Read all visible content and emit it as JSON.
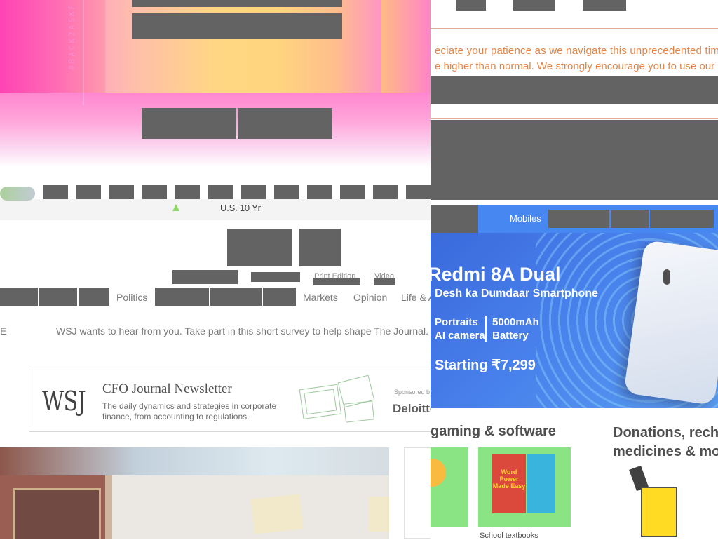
{
  "hero": {
    "vertical_text": "#BACK2ASKF"
  },
  "ticker": {
    "label": "U.S. 10 Yr",
    "direction": "up",
    "up_color": "#7cd34a"
  },
  "wsj_nav": {
    "items": [
      "Politics",
      "Markets",
      "Opinion",
      "Life & A"
    ],
    "small_links": [
      "Print Edition",
      "Video"
    ]
  },
  "survey": {
    "prefix": "E",
    "text": "WSJ wants to hear from you. Take part in this short survey to help shape The Journal. T"
  },
  "ad": {
    "logo": "WSJ",
    "title": "CFO Journal Newsletter",
    "description": "The daily dynamics and strategies in corporate finance, from accounting to regulations.",
    "sponsor_label": "Sponsored b",
    "sponsor": "Deloitte"
  },
  "notice": {
    "line1": "eciate your patience as we navigate this unprecedented time",
    "line2": "e higher than normal. We strongly encourage you to use our",
    "color": "#e07028"
  },
  "flipkart": {
    "nav_label": "Mobiles",
    "banner": {
      "headline": "Redmi 8A Dual",
      "subhead": "Desh ka Dumdaar Smartphone",
      "feature1": "Portraits\nAI camera",
      "feature2": "5000mAh\nBattery",
      "price": "Starting ₹7,299"
    },
    "cards": [
      {
        "title": "gaming & software",
        "caption": "School textbooks",
        "book_title": "Word Power Made Easy"
      },
      {
        "title": "Donations, rech\nmedicines & mo"
      }
    ]
  }
}
